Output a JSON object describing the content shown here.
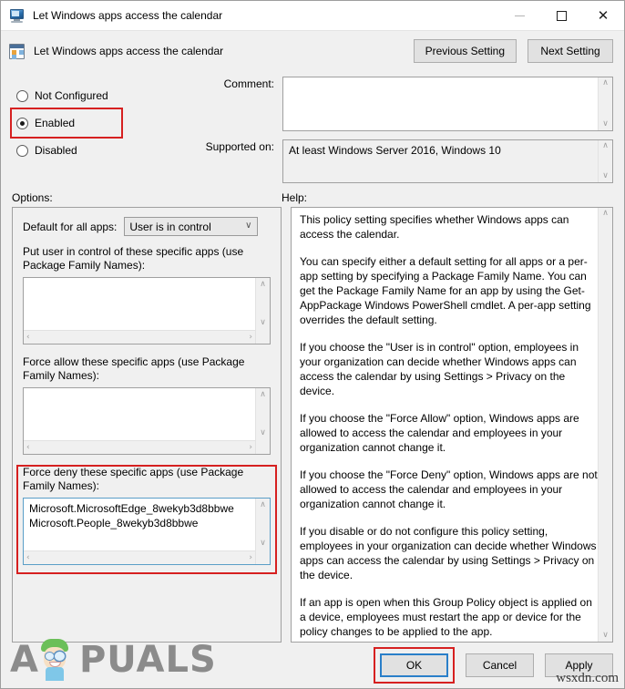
{
  "window": {
    "title": "Let Windows apps access the calendar",
    "minimize_label": "—",
    "maximize_label": "☐",
    "close_label": "✕"
  },
  "header": {
    "setting_title": "Let Windows apps access the calendar",
    "previous_button": "Previous Setting",
    "next_button": "Next Setting"
  },
  "state": {
    "options": [
      {
        "label": "Not Configured",
        "selected": false,
        "highlighted": false
      },
      {
        "label": "Enabled",
        "selected": true,
        "highlighted": true
      },
      {
        "label": "Disabled",
        "selected": false,
        "highlighted": false
      }
    ]
  },
  "fields": {
    "comment_label": "Comment:",
    "comment_value": "",
    "supported_label": "Supported on:",
    "supported_value": "At least Windows Server 2016, Windows 10"
  },
  "sections": {
    "options_label": "Options:",
    "help_label": "Help:"
  },
  "options_pane": {
    "default_label": "Default for all apps:",
    "default_value": "User is in control",
    "default_chevron": "∨",
    "user_control_caption": "Put user in control of these specific apps (use Package Family Names):",
    "user_control_items": "",
    "force_allow_caption": "Force allow these specific apps (use Package Family Names):",
    "force_allow_items": "",
    "force_deny_caption": "Force deny these specific apps (use Package Family Names):",
    "force_deny_items": "Microsoft.MicrosoftEdge_8wekyb3d8bbwe\nMicrosoft.People_8wekyb3d8bbwe"
  },
  "help": {
    "paragraphs": [
      "This policy setting specifies whether Windows apps can access the calendar.",
      "You can specify either a default setting for all apps or a per-app setting by specifying a Package Family Name. You can get the Package Family Name for an app by using the Get-AppPackage Windows PowerShell cmdlet. A per-app setting overrides the default setting.",
      "If you choose the \"User is in control\" option, employees in your organization can decide whether Windows apps can access the calendar by using Settings > Privacy on the device.",
      "If you choose the \"Force Allow\" option, Windows apps are allowed to access the calendar and employees in your organization cannot change it.",
      "If you choose the \"Force Deny\" option, Windows apps are not allowed to access the calendar and employees in your organization cannot change it.",
      "If you disable or do not configure this policy setting, employees in your organization can decide whether Windows apps can access the calendar by using Settings > Privacy on the device.",
      "If an app is open when this Group Policy object is applied on a device, employees must restart the app or device for the policy changes to be applied to the app."
    ]
  },
  "footer": {
    "ok_label": "OK",
    "cancel_label": "Cancel",
    "apply_label": "Apply"
  },
  "watermarks": {
    "brand_part1": "A",
    "brand_part2": "PUALS",
    "site": "wsxdn.com"
  },
  "scroll_glyphs": {
    "up": "∧",
    "down": "∨",
    "left": "‹",
    "right": "›"
  },
  "colors": {
    "annotation_red": "#d62020",
    "focus_blue": "#2a7fc9",
    "window_bg": "#f0f0f0"
  }
}
